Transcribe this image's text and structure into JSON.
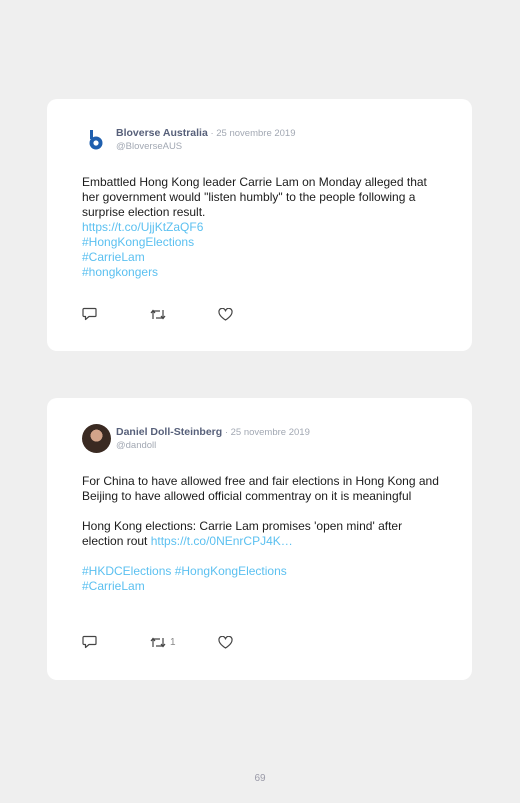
{
  "tweets": [
    {
      "author": "Bloverse Australia",
      "date": " · 25 novembre 2019",
      "handle": "@BloverseAUS",
      "text": "Embattled Hong Kong leader Carrie Lam on Monday alleged that her government would \"listen humbly\" to the people following a surprise election result.",
      "links": [
        "https://t.co/UjjKtZaQF6",
        "#HongKongElections",
        "#CarrieLam",
        "#hongkongers"
      ],
      "retweets": ""
    },
    {
      "author": "Daniel Doll-Steinberg",
      "date": " · 25 novembre 2019",
      "handle": "@dandoll",
      "text1": "For China to have allowed free and fair elections in Hong Kong and Beijing to have allowed official commentray on it is meaningful",
      "text2": "Hong Kong elections: Carrie Lam promises 'open mind' after election rout ",
      "text2_link": "https://t.co/0NEnrCPJ4K…",
      "hashtags1": "#HKDCElections #HongKongElections",
      "hashtags2": "#CarrieLam",
      "retweets": "1"
    }
  ],
  "page_number": "69",
  "colors": {
    "link": "#5bc0f0",
    "name": "#57607a",
    "meta": "#a2a8b3",
    "background": "#efefef"
  }
}
